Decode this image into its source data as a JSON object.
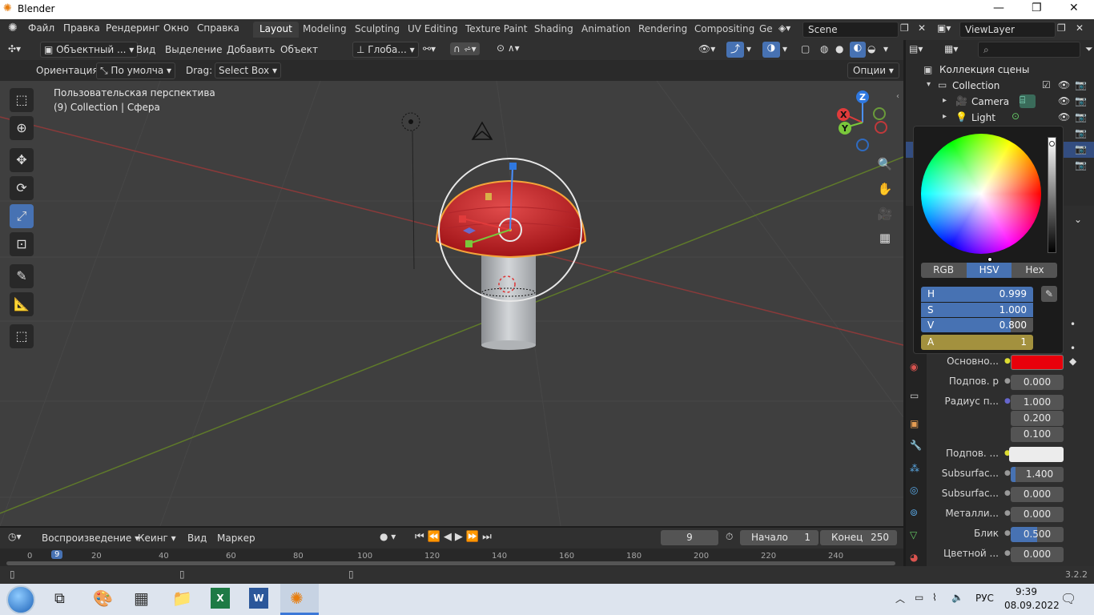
{
  "window": {
    "title": "Blender",
    "min": "—",
    "max": "❐",
    "close": "✕"
  },
  "menu": [
    "Файл",
    "Правка",
    "Рендеринг",
    "Окно",
    "Справка"
  ],
  "workspaces": [
    "Layout",
    "Modeling",
    "Sculpting",
    "UV Editing",
    "Texture Paint",
    "Shading",
    "Animation",
    "Rendering",
    "Compositing",
    "Ge"
  ],
  "scene": "Scene",
  "view_layer": "ViewLayer",
  "header": {
    "mode": "Объектный ...",
    "view": "Вид",
    "select": "Выделение",
    "add": "Добавить",
    "object": "Объект",
    "transform": "Глоба..."
  },
  "toolsettings": {
    "orient_label": "Ориентация:",
    "orient_value": "По умолча",
    "drag_label": "Drag:",
    "drag_value": "Select Box",
    "options": "Опции"
  },
  "viewport": {
    "line1": "Пользовательская перспектива",
    "line2": "(9) Collection | Сфера"
  },
  "gizmo": {
    "x": "X",
    "y": "Y",
    "z": "Z"
  },
  "outliner": {
    "root": "Коллекция сцены",
    "items": [
      {
        "label": "Collection",
        "icon": "collection-icon"
      },
      {
        "label": "Camera",
        "icon": "camera-icon"
      },
      {
        "label": "Light",
        "icon": "light-icon"
      }
    ]
  },
  "color_picker": {
    "tabs": [
      "RGB",
      "HSV",
      "Hex"
    ],
    "active_tab": "HSV",
    "fields": [
      {
        "label": "H",
        "value": "0.999"
      },
      {
        "label": "S",
        "value": "1.000"
      },
      {
        "label": "V",
        "value": "0.800"
      },
      {
        "label": "A",
        "value": "1"
      }
    ]
  },
  "properties": {
    "base_color_label": "Основно...",
    "base_color": "#e8000b",
    "rows": [
      {
        "label": "Подпов. р",
        "value": "0.000"
      },
      {
        "label": "Радиус п...",
        "value": "1.000"
      },
      {
        "label": "",
        "value": "0.200"
      },
      {
        "label": "",
        "value": "0.100"
      }
    ],
    "sub_color_label": "Подпов. ...",
    "rows2": [
      {
        "label": "Subsurfac...",
        "value": "1.400"
      },
      {
        "label": "Subsurfac...",
        "value": "0.000"
      },
      {
        "label": "Металли...",
        "value": "0.000"
      },
      {
        "label": "Блик",
        "value": "0.500"
      },
      {
        "label": "Цветной ...",
        "value": "0.000"
      }
    ]
  },
  "timeline": {
    "playback": "Воспроизведение",
    "keying": "Кеинг",
    "view": "Вид",
    "marker": "Маркер",
    "current_frame": "9",
    "start_label": "Начало",
    "start": "1",
    "end_label": "Конец",
    "end": "250",
    "ticks": [
      "0",
      "9",
      "20",
      "40",
      "60",
      "80",
      "100",
      "120",
      "140",
      "160",
      "180",
      "200",
      "220",
      "240"
    ]
  },
  "version": "3.2.2",
  "taskbar": {
    "lang": "РУС",
    "time": "9:39",
    "date": "08.09.2022"
  }
}
